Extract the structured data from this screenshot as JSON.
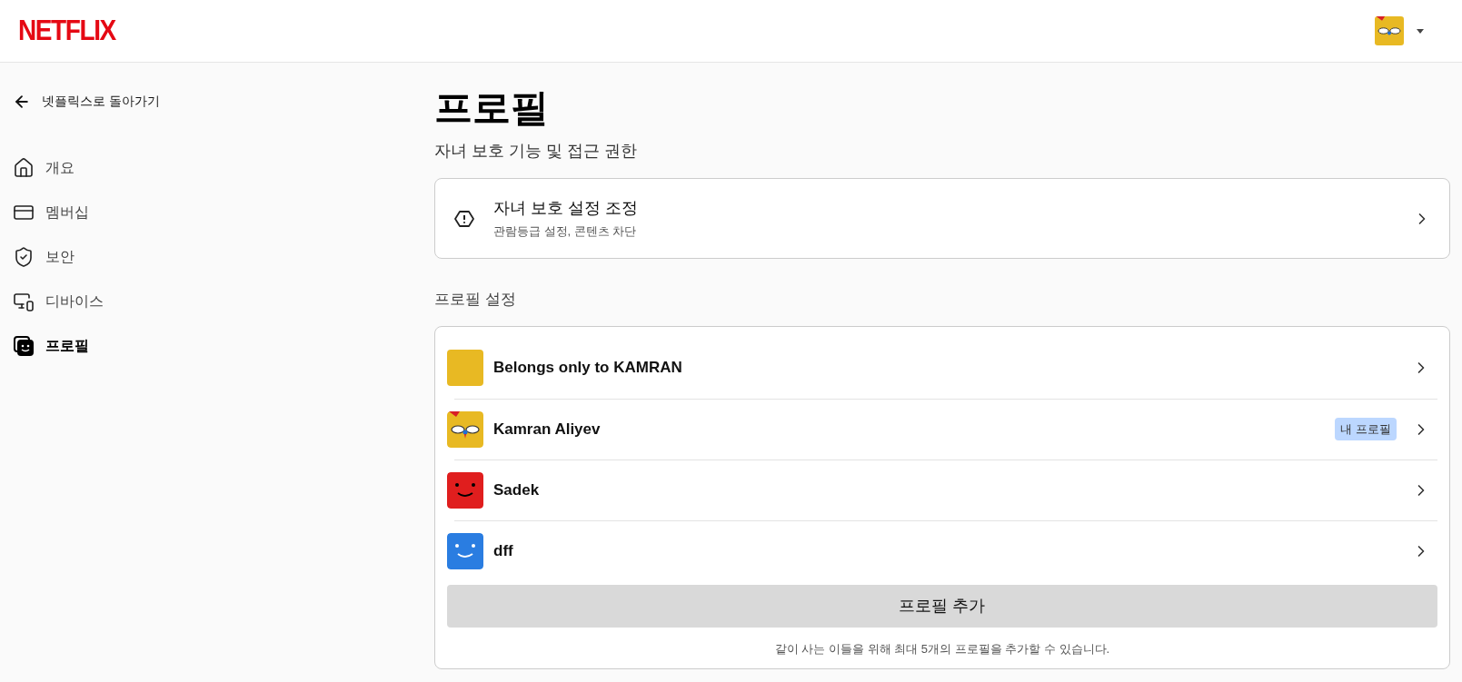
{
  "header": {
    "logo": "NETFLIX",
    "account_avatar": {
      "color": "#e8b923"
    }
  },
  "sidebar": {
    "back_link": "넷플릭스로 돌아가기",
    "items": [
      {
        "kind": "home",
        "label": "개요",
        "selected": false
      },
      {
        "kind": "card",
        "label": "멤버십",
        "selected": false
      },
      {
        "kind": "shield",
        "label": "보안",
        "selected": false
      },
      {
        "kind": "devices",
        "label": "디바이스",
        "selected": false
      },
      {
        "kind": "profile",
        "label": "프로필",
        "selected": true
      }
    ]
  },
  "main": {
    "title": "프로필",
    "subtitle": "자녀 보호 기능 및 접근 권한",
    "parental_card": {
      "title": "자녀 보호 설정 조정",
      "description": "관람등급 설정, 콘텐츠 차단"
    },
    "section_title": "프로필 설정",
    "profiles": [
      {
        "name": "Belongs only to KAMRAN",
        "kind": "photo",
        "color": "#e8b923"
      },
      {
        "name": "Kamran Aliyev",
        "kind": "bird",
        "color": "#e8b923",
        "badge": "내 프로필"
      },
      {
        "name": "Sadek",
        "kind": "dark_smile",
        "color": "#e01e1e"
      },
      {
        "name": "dff",
        "kind": "light_smile",
        "color": "#2a7de1"
      }
    ],
    "add_button": "프로필 추가",
    "note": "같이 사는 이들을 위해 최대 5개의 프로필을 추가할 수 있습니다."
  }
}
